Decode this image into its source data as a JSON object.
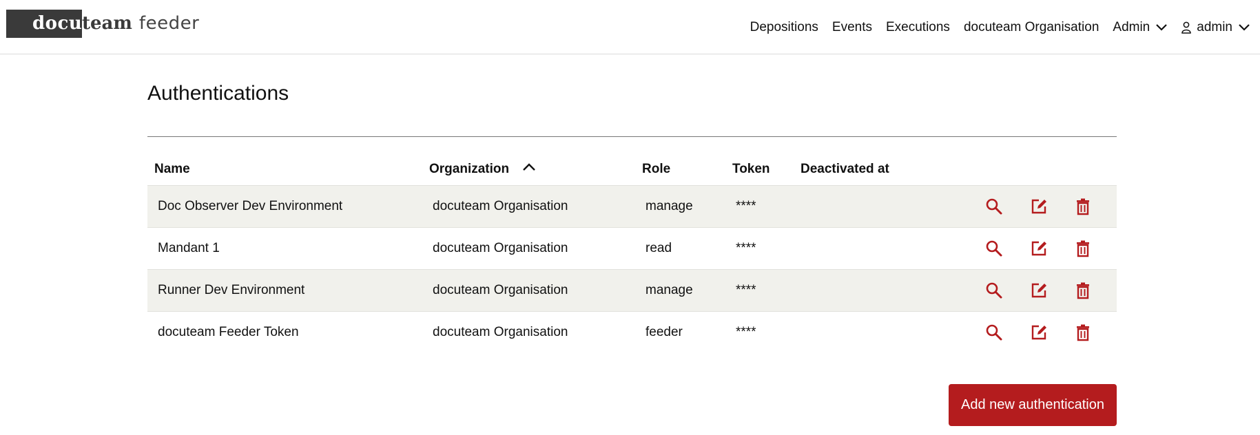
{
  "header": {
    "logo_part1": "docu",
    "logo_part2": "team",
    "logo_part3": "feeder",
    "nav": {
      "depositions": "Depositions",
      "events": "Events",
      "executions": "Executions",
      "organisation": "docuteam Organisation",
      "admin_menu": "Admin",
      "user_menu": "admin"
    }
  },
  "page": {
    "title": "Authentications"
  },
  "table": {
    "columns": {
      "name": "Name",
      "organization": "Organization",
      "role": "Role",
      "token": "Token",
      "deactivated_at": "Deactivated at"
    },
    "sort": {
      "column": "organization",
      "direction": "ascending"
    },
    "rows": [
      {
        "name": "Doc Observer Dev Environment",
        "organization": "docuteam Organisation",
        "role": "manage",
        "token": "****",
        "deactivated_at": ""
      },
      {
        "name": "Mandant 1",
        "organization": "docuteam Organisation",
        "role": "read",
        "token": "****",
        "deactivated_at": ""
      },
      {
        "name": "Runner Dev Environment",
        "organization": "docuteam Organisation",
        "role": "manage",
        "token": "****",
        "deactivated_at": ""
      },
      {
        "name": "docuteam Feeder Token",
        "organization": "docuteam Organisation",
        "role": "feeder",
        "token": "****",
        "deactivated_at": ""
      }
    ]
  },
  "actions": {
    "add_label": "Add new authentication"
  },
  "colors": {
    "accent": "#b41c1e",
    "row_shade": "#f1f1ec",
    "logo_dark": "#3a3a3a"
  },
  "icons": {
    "view": "search-icon",
    "edit": "edit-icon",
    "delete": "trash-icon",
    "sort": "chevron-up-icon",
    "dropdown": "chevron-down-icon",
    "user": "user-icon"
  }
}
